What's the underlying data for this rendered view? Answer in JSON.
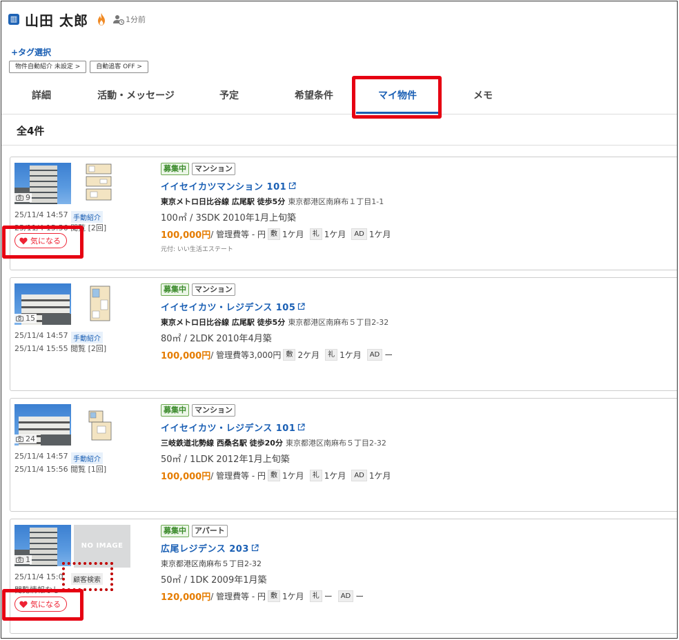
{
  "header": {
    "building_icon": "building-icon",
    "name": "山田 太郎",
    "fire_icon": "fire-icon",
    "person_icon": "person-clock-icon",
    "last_activity": "1分前"
  },
  "tag_select": "+タグ選択",
  "pills": {
    "auto_intro": "物件自動紹介 未設定 >",
    "auto_chase": "自動追客 OFF >"
  },
  "tabs": [
    "詳細",
    "活動・メッセージ",
    "予定",
    "希望条件",
    "マイ物件",
    "メモ"
  ],
  "active_tab": "マイ物件",
  "count": "全4件",
  "properties": [
    {
      "photo_count": "9",
      "date1": "25/11/4 14:57",
      "badge": "手動紹介",
      "date2": "25/11/4 15:56 閲覧 [2回]",
      "fav": "気になる",
      "status": "募集中",
      "type": "マンション",
      "name": "イイセイカツマンション 101",
      "station": "東京メトロ日比谷線 広尾駅 徒歩5分",
      "address": "東京都港区南麻布１丁目1-1",
      "spec": "100㎡ / 3SDK  2010年1月上旬築",
      "rent": "100,000円",
      "fee": " / 管理費等 - 円",
      "shiki_label": "敷",
      "shiki": "1ケ月",
      "rei_label": "礼",
      "rei": "1ケ月",
      "ad_label": "AD",
      "ad": "1ケ月",
      "motoduke": "元付: いい生活エステート"
    },
    {
      "photo_count": "15",
      "date1": "25/11/4 14:57",
      "badge": "手動紹介",
      "date2": "25/11/4 15:55 閲覧 [2回]",
      "status": "募集中",
      "type": "マンション",
      "name": "イイセイカツ・レジデンス 105",
      "station": "東京メトロ日比谷線 広尾駅 徒歩5分",
      "address": "東京都港区南麻布５丁目2-32",
      "spec": "80㎡ / 2LDK  2010年4月築",
      "rent": "100,000円",
      "fee": " / 管理費等3,000円",
      "shiki_label": "敷",
      "shiki": "2ケ月",
      "rei_label": "礼",
      "rei": "1ケ月",
      "ad_label": "AD",
      "ad": "ー"
    },
    {
      "photo_count": "24",
      "date1": "25/11/4 14:57",
      "badge": "手動紹介",
      "date2": "25/11/4 15:56 閲覧 [1回]",
      "status": "募集中",
      "type": "マンション",
      "name": "イイセイカツ・レジデンス 101",
      "station": "三岐鉄道北勢線 西桑名駅 徒歩20分",
      "address": "東京都港区南麻布５丁目2-32",
      "spec": "50㎡ / 1LDK  2012年1月上旬築",
      "rent": "100,000円",
      "fee": " / 管理費等 - 円",
      "shiki_label": "敷",
      "shiki": "1ケ月",
      "rei_label": "礼",
      "rei": "1ケ月",
      "ad_label": "AD",
      "ad": "1ケ月"
    },
    {
      "photo_count": "1",
      "no_image": "NO IMAGE",
      "date1": "25/11/4 15:0",
      "badge": "顧客検索",
      "date2": "閲覧情報なし",
      "fav": "気になる",
      "status": "募集中",
      "type": "アパート",
      "name": "広尾レジデンス 203",
      "address": "東京都港区南麻布５丁目2-32",
      "spec": "50㎡ / 1DK  2009年1月築",
      "rent": "120,000円",
      "fee": " / 管理費等 - 円",
      "shiki_label": "敷",
      "shiki": "1ケ月",
      "rei_label": "礼",
      "rei": "ー",
      "ad_label": "AD",
      "ad": "ー"
    }
  ],
  "colors": {
    "accent": "#1a5fb4",
    "price": "#e57c00",
    "highlight": "#e60012",
    "status_green": "#3a8a2a"
  }
}
